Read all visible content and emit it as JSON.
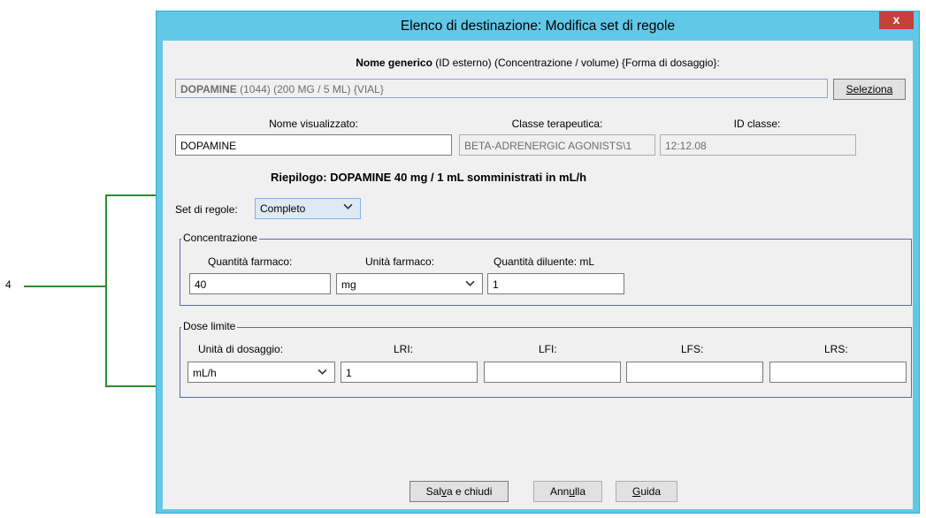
{
  "callout": {
    "number": "4"
  },
  "window": {
    "title": "Elenco di destinazione: Modifica set di regole",
    "close_label": "x"
  },
  "generic": {
    "header_bold": "Nome generico",
    "header_rest": " (ID esterno) (Concentrazione / volume) {Forma di dosaggio}:",
    "value_bold": "DOPAMINE",
    "value_rest": " (1044) (200 MG / 5 ML) {VIAL}",
    "select_label": "Seleziona"
  },
  "display": {
    "name_label": "Nome visualizzato:",
    "name_value": "DOPAMINE",
    "class_label": "Classe terapeutica:",
    "class_value": "BETA-ADRENERGIC AGONISTS\\1",
    "classid_label": "ID classe:",
    "classid_value": "12:12.08"
  },
  "summary": "Riepilogo: DOPAMINE 40 mg / 1 mL somministrati in mL/h",
  "ruleset": {
    "label": "Set di regole:",
    "value": "Completo"
  },
  "concentration": {
    "title": "Concentrazione",
    "drug_amount_label": "Quantità farmaco:",
    "drug_amount_value": "40",
    "drug_unit_label": "Unità farmaco:",
    "drug_unit_value": "mg",
    "diluent_label": "Quantità diluente: mL",
    "diluent_value": "1"
  },
  "limits": {
    "title": "Dose limite",
    "dose_unit_label": "Unità di dosaggio:",
    "dose_unit_value": "mL/h",
    "lri_label": "LRI:",
    "lri_value": "1",
    "lfi_label": "LFI:",
    "lfi_value": "",
    "lfs_label": "LFS:",
    "lfs_value": "",
    "lrs_label": "LRS:",
    "lrs_value": ""
  },
  "buttons": {
    "save_a": "Sal",
    "save_u": "v",
    "save_b": "a e chiudi",
    "cancel_a": "Ann",
    "cancel_u": "u",
    "cancel_b": "lla",
    "help_u": "G",
    "help_b": "uida"
  },
  "colors": {
    "title_bar": "#62c8e8",
    "close_button": "#c7403a",
    "group_border": "#5a6aa8",
    "callout_line": "#2e8b2e"
  },
  "icons": {
    "dropdown": "chevron-down-icon",
    "close": "close-icon"
  }
}
